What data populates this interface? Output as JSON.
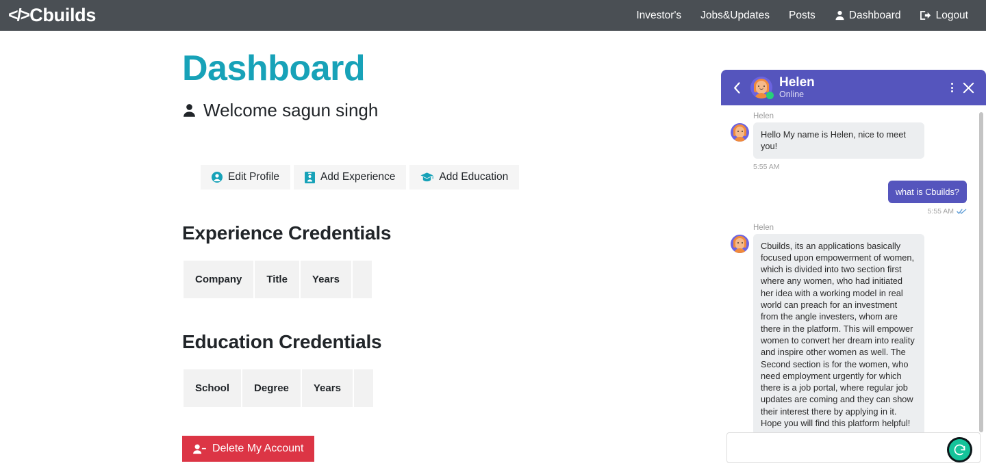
{
  "navbar": {
    "brand": "Cbuilds",
    "brand_icon": "code-glyph-icon",
    "links": [
      {
        "label": "Investor's",
        "icon": null
      },
      {
        "label": "Jobs&Updates",
        "icon": null
      },
      {
        "label": "Posts",
        "icon": null
      },
      {
        "label": "Dashboard",
        "icon": "user-icon"
      },
      {
        "label": "Logout",
        "icon": "sign-out-icon"
      }
    ],
    "background": "#4a4f54"
  },
  "main": {
    "page_title": "Dashboard",
    "page_title_color": "#17a2b8",
    "welcome_text": "Welcome sagun singh",
    "welcome_icon": "user-icon",
    "actions": [
      {
        "label": "Edit Profile",
        "icon": "user-circle-icon",
        "icon_color": "#17a2b8"
      },
      {
        "label": "Add Experience",
        "icon": "id-badge-icon",
        "icon_color": "#17a2b8"
      },
      {
        "label": "Add Education",
        "icon": "graduation-cap-icon",
        "icon_color": "#17a2b8"
      }
    ],
    "experience": {
      "heading": "Experience Credentials",
      "columns": [
        "Company",
        "Title",
        "Years",
        ""
      ],
      "rows": []
    },
    "education": {
      "heading": "Education Credentials",
      "columns": [
        "School",
        "Degree",
        "Years",
        ""
      ],
      "rows": []
    },
    "delete_button": {
      "label": "Delete My Account",
      "icon": "user-minus-icon",
      "color": "#dc3545"
    }
  },
  "chat": {
    "header": {
      "name": "Helen",
      "status": "Online",
      "back_icon": "chevron-left-icon",
      "menu_icon": "kebab-menu-icon",
      "close_icon": "close-icon",
      "avatar_icon": "helen-avatar",
      "online_indicator": "online-dot",
      "background": "#5555bd"
    },
    "messages": [
      {
        "side": "in",
        "sender": "Helen",
        "text": "Hello My name is Helen, nice to meet you!",
        "time": "5:55 AM",
        "read_receipt": null
      },
      {
        "side": "out",
        "sender": null,
        "text": "what is Cbuilds?",
        "time": "5:55 AM",
        "read_receipt": "double-check-icon"
      },
      {
        "side": "in",
        "sender": "Helen",
        "text": "Cbuilds, its an applications basically focused upon empowerment of women, which is divided into two section first where any women, who had initiated her idea with a working model in real world can preach for an investment from the angle investers, whom are there in the platform. This will empower women to convert her dream into reality and inspire other women as well. The  Second section is for the women, who need employment urgently for which there is a job portal, where regular job updates are coming and they can show their interest there by applying in it. Hope you will find this platform helpful!",
        "time": null,
        "read_receipt": null
      }
    ],
    "input": {
      "value": "",
      "placeholder": ""
    },
    "grammarly_icon": "grammarly-icon"
  }
}
